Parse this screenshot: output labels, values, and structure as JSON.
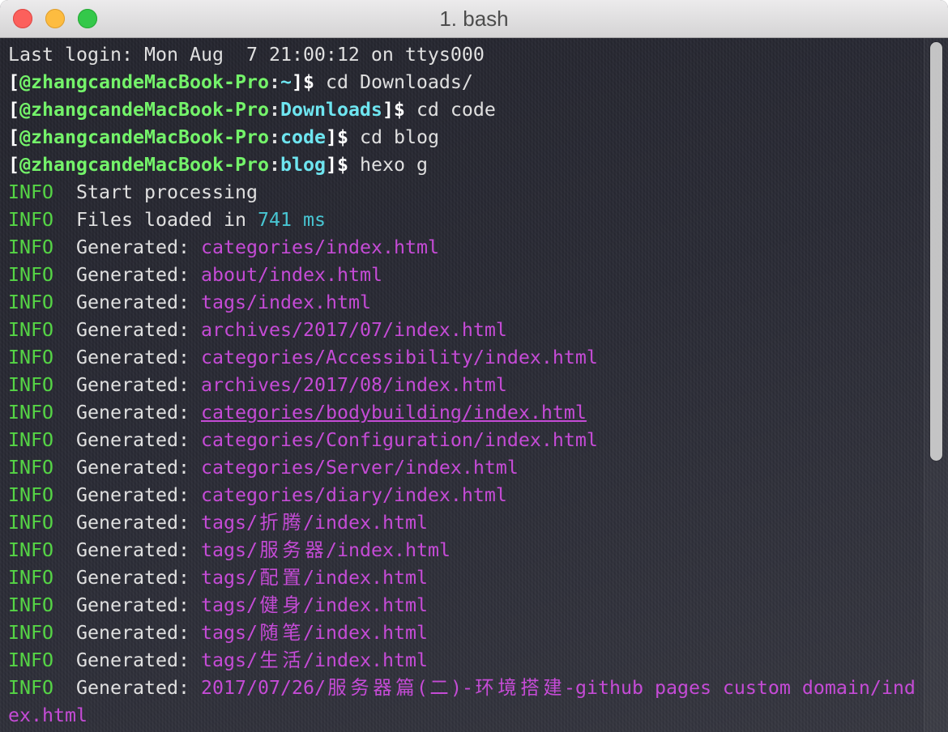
{
  "window": {
    "title": "1. bash",
    "controls": [
      "close-icon",
      "minimize-icon",
      "zoom-icon"
    ]
  },
  "colors": {
    "bg": "#2a2b35",
    "fg": "#e0e0e0",
    "bracket": "#ffffff",
    "host": "#74f36a",
    "cwd": "#6ee5f0",
    "info": "#55d545",
    "timing": "#48c6d3",
    "path": "#c54bd6"
  },
  "scroll": {
    "scrolled_percent": 0,
    "visible_percent": 61
  },
  "terminal": {
    "last_login": "Last login: Mon Aug  7 21:00:12 on ttys000",
    "prompts": [
      {
        "open": "[",
        "host": "@zhangcandeMacBook-Pro",
        "sep": ":",
        "cwd": "~",
        "close": "]$",
        "command": "cd Downloads/"
      },
      {
        "open": "[",
        "host": "@zhangcandeMacBook-Pro",
        "sep": ":",
        "cwd": "Downloads",
        "close": "]$",
        "command": "cd code"
      },
      {
        "open": "[",
        "host": "@zhangcandeMacBook-Pro",
        "sep": ":",
        "cwd": "code",
        "close": "]$",
        "command": "cd blog"
      },
      {
        "open": "[",
        "host": "@zhangcandeMacBook-Pro",
        "sep": ":",
        "cwd": "blog",
        "close": "]$",
        "command": "hexo g"
      }
    ],
    "log": [
      {
        "level": "INFO",
        "message": "Start processing"
      },
      {
        "level": "INFO",
        "message": "Files loaded in",
        "value": "741 ms"
      },
      {
        "level": "INFO",
        "message": "Generated:",
        "path": "categories/index.html"
      },
      {
        "level": "INFO",
        "message": "Generated:",
        "path": "about/index.html"
      },
      {
        "level": "INFO",
        "message": "Generated:",
        "path": "tags/index.html"
      },
      {
        "level": "INFO",
        "message": "Generated:",
        "path": "archives/2017/07/index.html"
      },
      {
        "level": "INFO",
        "message": "Generated:",
        "path": "categories/Accessibility/index.html"
      },
      {
        "level": "INFO",
        "message": "Generated:",
        "path": "archives/2017/08/index.html"
      },
      {
        "level": "INFO",
        "message": "Generated:",
        "path": "categories/bodybuilding/index.html"
      },
      {
        "level": "INFO",
        "message": "Generated:",
        "path": "categories/Configuration/index.html"
      },
      {
        "level": "INFO",
        "message": "Generated:",
        "path": "categories/Server/index.html"
      },
      {
        "level": "INFO",
        "message": "Generated:",
        "path": "categories/diary/index.html"
      },
      {
        "level": "INFO",
        "message": "Generated:",
        "path": "tags/折腾/index.html"
      },
      {
        "level": "INFO",
        "message": "Generated:",
        "path": "tags/服务器/index.html"
      },
      {
        "level": "INFO",
        "message": "Generated:",
        "path": "tags/配置/index.html"
      },
      {
        "level": "INFO",
        "message": "Generated:",
        "path": "tags/健身/index.html"
      },
      {
        "level": "INFO",
        "message": "Generated:",
        "path": "tags/随笔/index.html"
      },
      {
        "level": "INFO",
        "message": "Generated:",
        "path": "tags/生活/index.html"
      },
      {
        "level": "INFO",
        "message": "Generated:",
        "path": "2017/07/26/服务器篇(二)-环境搭建-github pages custom domain/ind",
        "path_continued": "ex.html"
      }
    ]
  }
}
